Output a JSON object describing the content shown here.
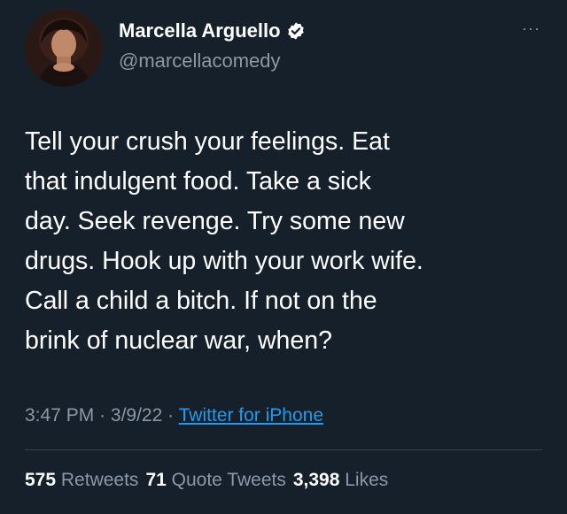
{
  "user": {
    "display_name": "Marcella Arguello",
    "handle": "@marcellacomedy",
    "verified": true,
    "verified_color": "#1d9bf0"
  },
  "more_label": "···",
  "tweet": {
    "text": "Tell your crush your feelings. Eat\nthat indulgent food. Take a sick\nday. Seek revenge. Try some new\ndrugs. Hook up with your work wife.\nCall a child a bitch. If not on the\nbrink of nuclear war, when?"
  },
  "meta": {
    "time": "3:47 PM",
    "separator": "·",
    "date": "3/9/22",
    "source": "Twitter for iPhone"
  },
  "stats": {
    "retweets_count": "575",
    "retweets_label": "Retweets",
    "quotes_count": "71",
    "quotes_label": "Quote Tweets",
    "likes_count": "3,398",
    "likes_label": "Likes"
  },
  "colors": {
    "background": "#15202b",
    "secondary_text": "#8b98a5",
    "link": "#1d9bf0"
  }
}
